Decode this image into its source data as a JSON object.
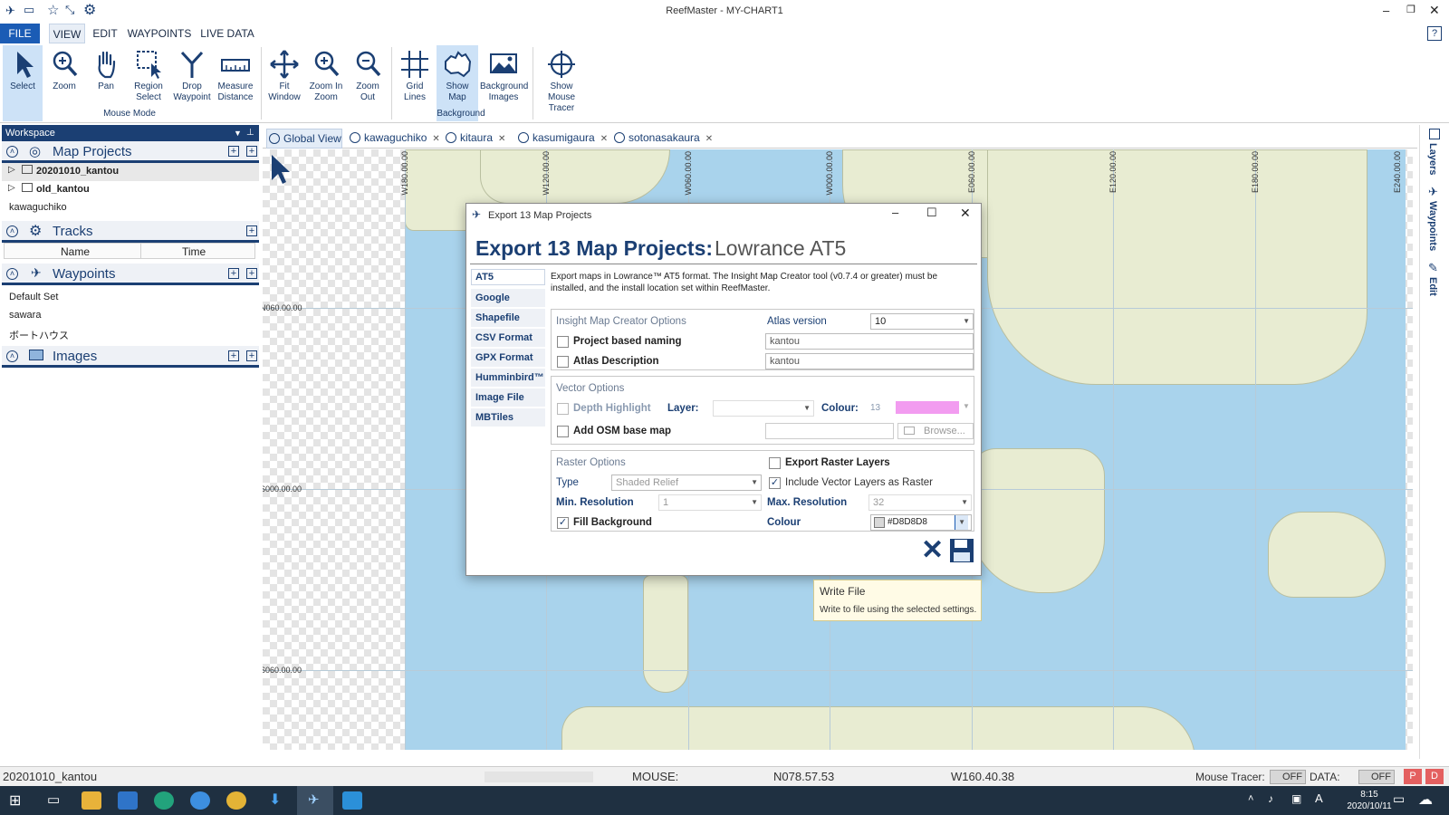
{
  "app": {
    "title": "ReefMaster - MY-CHART1"
  },
  "menu": [
    "FILE",
    "VIEW",
    "EDIT",
    "WAYPOINTS",
    "LIVE DATA"
  ],
  "ribbon": {
    "buttons": [
      "Select",
      "Zoom",
      "Pan",
      "Region Select",
      "Drop Waypoint",
      "Measure Distance",
      "Fit Window",
      "Zoom In Zoom",
      "Zoom Out",
      "Grid Lines",
      "Show Map",
      "Background Images",
      "Show Mouse Tracer"
    ],
    "groups": {
      "mouse_mode": "Mouse Mode",
      "background": "Background"
    }
  },
  "workspace": {
    "title": "Workspace",
    "map_projects": {
      "title": "Map Projects",
      "items": [
        "20201010_kantou",
        "old_kantou",
        "kawaguchiko"
      ]
    },
    "tracks": {
      "title": "Tracks",
      "col_name": "Name",
      "col_time": "Time"
    },
    "waypoints": {
      "title": "Waypoints",
      "items": [
        "Default Set",
        "sawara",
        "ボートハウス"
      ]
    },
    "images": {
      "title": "Images"
    }
  },
  "tabs": [
    "Global View",
    "kawaguchiko",
    "kitaura",
    "kasumigaura",
    "sotonasakaura"
  ],
  "map": {
    "lon_labels": [
      "W180.00.00",
      "W120.00.00",
      "W060.00.00",
      "W000.00.00",
      "E060.00.00",
      "E120.00.00",
      "E180.00.00",
      "E240.00.00"
    ],
    "lat_labels": [
      "N060.00.00",
      "S000.00.00",
      "S060.00.00"
    ]
  },
  "sidebar": [
    "Layers",
    "Waypoints",
    "Edit"
  ],
  "dialog": {
    "window_title": "Export 13 Map Projects",
    "heading": "Export 13 Map Projects:",
    "format": "Lowrance AT5",
    "tabs": [
      "AT5",
      "Google Earth™",
      "Shapefile",
      "CSV Format",
      "GPX Format",
      "Humminbird™",
      "Image File",
      "MBTiles"
    ],
    "description": "Export maps in Lowrance™ AT5 format. The Insight Map Creator tool (v0.7.4 or greater) must be installed, and the install location set within ReefMaster.",
    "insight": {
      "title": "Insight Map Creator Options",
      "atlas_version_label": "Atlas version",
      "atlas_version": "10",
      "project_naming_label": "Project based naming",
      "project_naming_value": "kantou",
      "atlas_desc_label": "Atlas Description",
      "atlas_desc_value": "kantou"
    },
    "vector": {
      "title": "Vector Options",
      "depth_highlight": "Depth Highlight",
      "layer_label": "Layer:",
      "colour_label": "Colour:",
      "colour_num": "13",
      "osm_label": "Add OSM base map",
      "browse": "Browse..."
    },
    "raster": {
      "title": "Raster Options",
      "export_raster": "Export Raster Layers",
      "type_label": "Type",
      "type_value": "Shaded Relief",
      "include_vector": "Include Vector Layers as Raster",
      "min_res_label": "Min. Resolution",
      "min_res": "1",
      "max_res_label": "Max. Resolution",
      "max_res": "32",
      "fill_bg": "Fill Background",
      "colour_label": "Colour",
      "colour_value": "#D8D8D8"
    }
  },
  "tooltip": {
    "title": "Write File",
    "text": "Write to file using the selected settings."
  },
  "status": {
    "project": "20201010_kantou",
    "mouse_label": "MOUSE:",
    "lat": "N078.57.53",
    "lon": "W160.40.38",
    "tracer_label": "Mouse Tracer:",
    "tracer_value": "OFF",
    "data_label": "DATA:",
    "data_value": "OFF"
  },
  "clock": {
    "time": "8:15",
    "date": "2020/10/11"
  },
  "colors": {
    "accent": "#1b3f73",
    "ocean": "#a9d3ec",
    "land": "#e8ecd2",
    "pink": "#f29cf0",
    "tooltip_bg": "#fffbe6"
  }
}
